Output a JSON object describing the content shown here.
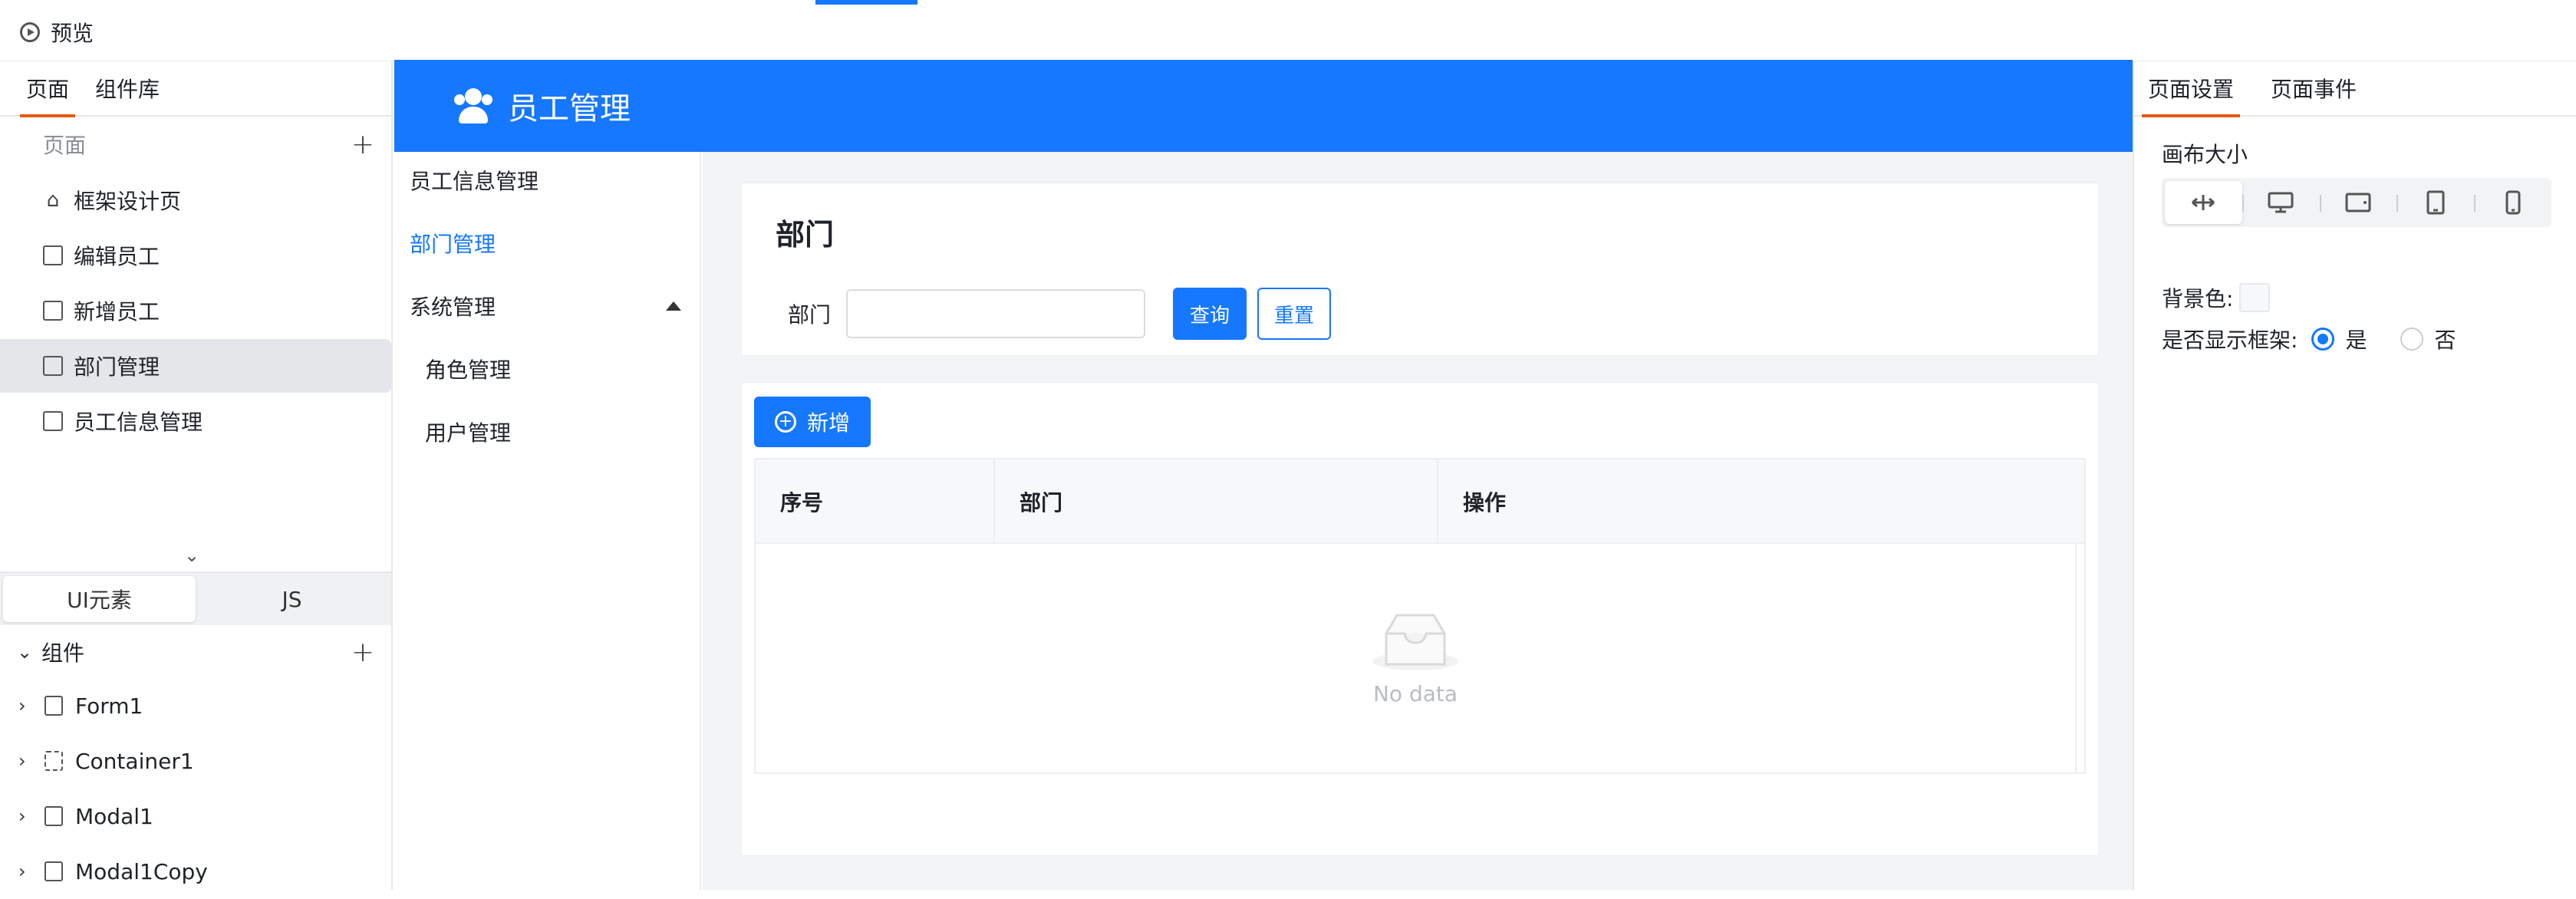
{
  "topbar": {
    "preview_label": "预览"
  },
  "left_panel": {
    "tabs": [
      {
        "label": "页面"
      },
      {
        "label": "组件库"
      }
    ],
    "page_section": {
      "title": "页面"
    },
    "pages": [
      {
        "label": "框架设计页",
        "icon": "home-icon"
      },
      {
        "label": "编辑员工",
        "icon": "page-icon"
      },
      {
        "label": "新增员工",
        "icon": "page-icon"
      },
      {
        "label": "部门管理",
        "icon": "page-icon"
      },
      {
        "label": "员工信息管理",
        "icon": "page-icon"
      }
    ],
    "subtabs": [
      {
        "label": "UI元素"
      },
      {
        "label": "JS"
      }
    ],
    "components_title": "组件",
    "components": [
      {
        "label": "Form1",
        "icon": "form-icon"
      },
      {
        "label": "Container1",
        "icon": "container-icon"
      },
      {
        "label": "Modal1",
        "icon": "modal-icon"
      },
      {
        "label": "Modal1Copy",
        "icon": "modal-icon"
      }
    ]
  },
  "app": {
    "title": "员工管理",
    "brand_color": "#1677ff",
    "menu": [
      {
        "label": "员工信息管理"
      },
      {
        "label": "部门管理"
      },
      {
        "label": "系统管理"
      },
      {
        "label": "角色管理"
      },
      {
        "label": "用户管理"
      }
    ],
    "search_card": {
      "title": "部门",
      "field_label": "部门",
      "field_value": "",
      "query_button": "查询",
      "reset_button": "重置"
    },
    "table_card": {
      "add_button": "新增",
      "columns": [
        "序号",
        "部门",
        "操作"
      ],
      "rows": [],
      "empty_text": "No data"
    }
  },
  "right_panel": {
    "tabs": [
      {
        "label": "页面设置"
      },
      {
        "label": "页面事件"
      }
    ],
    "canvas_size_label": "画布大小",
    "device_options": [
      "fit-width-icon",
      "desktop-icon",
      "tablet-landscape-icon",
      "tablet-portrait-icon",
      "phone-icon"
    ],
    "background_label": "背景色:",
    "background_value": "#f7f8fa",
    "show_frame_label": "是否显示框架:",
    "show_frame_options": [
      "是",
      "否"
    ],
    "show_frame_selected": "是",
    "accent_color": "#e8590c"
  }
}
